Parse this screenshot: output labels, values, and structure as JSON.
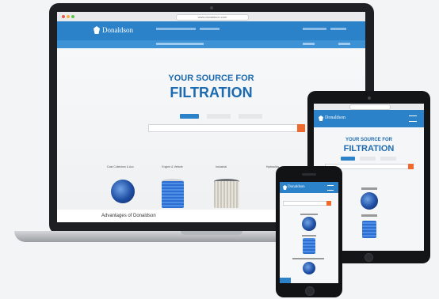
{
  "laptop": {
    "url": "www.donaldson.com",
    "logo": "Donaldson",
    "hero_subtitle": "YOUR SOURCE FOR",
    "hero_title": "FILTRATION",
    "categories": [
      "Dust Collectors & Acc",
      "Engine & Vehicle",
      "Industrial",
      "Hydraulics"
    ],
    "advantages_heading": "Advantages of Donaldson"
  },
  "tablet": {
    "logo": "Donaldson",
    "hero_subtitle": "YOUR SOURCE FOR",
    "hero_title": "FILTRATION"
  },
  "phone": {
    "logo": "Donaldson"
  },
  "colors": {
    "brand_blue": "#2b82c9",
    "accent_orange": "#ef6a2c",
    "title_blue": "#1c6bb0"
  }
}
